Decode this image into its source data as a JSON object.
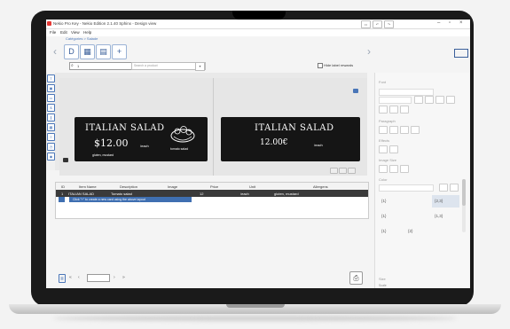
{
  "app": {
    "title": "Nekio Pro Key - Nekio Edition 2.1.40 Sphinx - Design view",
    "breadcrumb": "Catégories > Salade"
  },
  "menu": [
    "File",
    "Edit",
    "View",
    "Help"
  ],
  "search": {
    "value": "1",
    "placeholder": "Search a product",
    "checkbox_label": "Hide label rewards"
  },
  "cards": [
    {
      "title": "ITALIAN SALAD",
      "price": "$12.00",
      "unit": "/each",
      "allergens": "gluten, mustard",
      "note": "tomato salad"
    },
    {
      "title": "ITALIAN SALAD",
      "price": "12.00€",
      "unit": "/each"
    }
  ],
  "table": {
    "columns": [
      "ID",
      "Item Name",
      "Description",
      "Image",
      "Price",
      "Unit",
      "Allergens"
    ],
    "rows": [
      {
        "id": "1",
        "name": "ITALIAN SALAD",
        "description": "Tomato salad",
        "image": "",
        "price": "12",
        "unit": "/each",
        "allergens": "gluten, mustard"
      }
    ],
    "tip": "Click \"+\" to create a new card using the above layout"
  },
  "right_panel": {
    "sections": [
      "Font",
      "Paragraph",
      "Effects",
      "Image Size",
      "Color",
      "Size"
    ],
    "values": [
      "{1}",
      "{2,3}",
      "{1}",
      "{1,3}",
      "{1}",
      "{2}"
    ],
    "bottom_label": "Scale"
  },
  "colors": {
    "accent": "#3f6fb1",
    "card_bg": "#151515",
    "row_selected": "#3a3a3a"
  }
}
